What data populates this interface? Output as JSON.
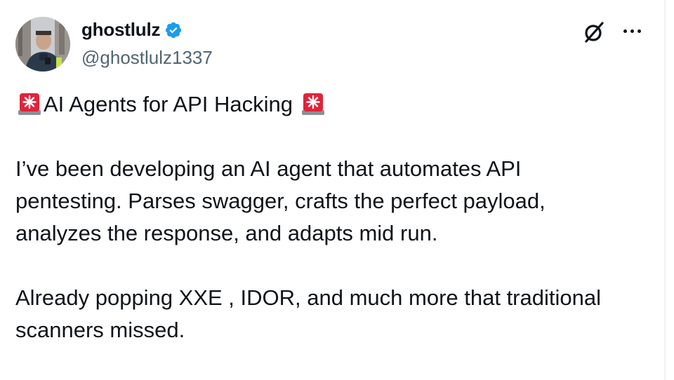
{
  "author": {
    "display_name": "ghostlulz",
    "handle": "@ghostlulz1337",
    "verified": true,
    "verified_color": "#1d9bf0"
  },
  "icons": {
    "verified": "verified-badge-icon",
    "grok": "grok-icon",
    "more": "more-options-icon",
    "siren": "rotating-light-icon"
  },
  "tweet": {
    "headline": "AI Agents for API Hacking",
    "paragraph_1": "I’ve been developing an AI agent that automates API pentesting. Parses swagger, crafts the perfect payload, analyzes the response, and adapts mid run.",
    "paragraph_2": "Already popping XXE , IDOR, and much more that traditional scanners missed."
  },
  "colors": {
    "text": "#0f1419",
    "secondary_text": "#536471",
    "siren_red": "#e0243a"
  }
}
